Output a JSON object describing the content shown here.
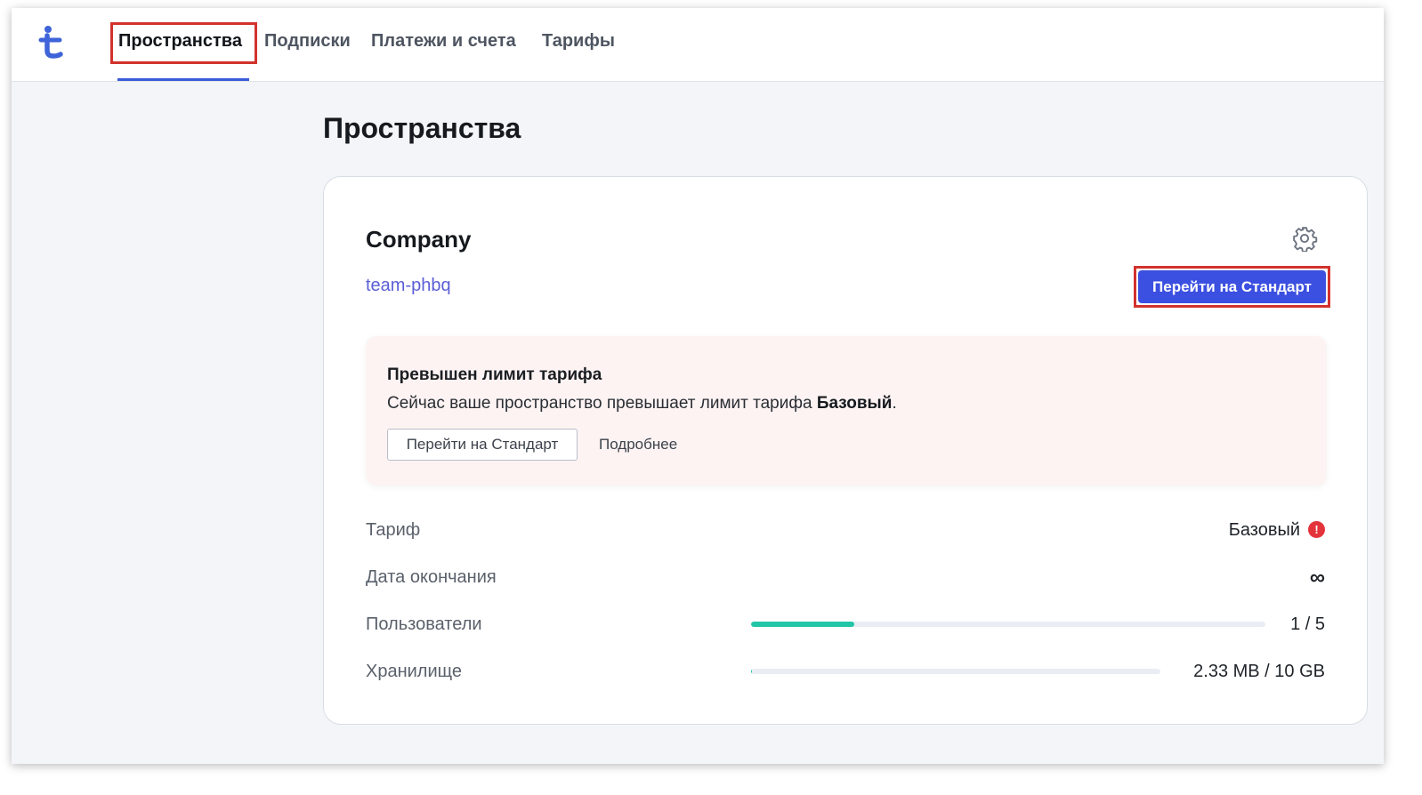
{
  "nav": {
    "items": [
      {
        "label": "Пространства",
        "active": true
      },
      {
        "label": "Подписки"
      },
      {
        "label": "Платежи и счета"
      },
      {
        "label": "Тарифы"
      }
    ]
  },
  "page": {
    "title": "Пространства"
  },
  "workspace": {
    "name": "Company",
    "slug": "team-phbq",
    "upgrade_label": "Перейти на Стандарт",
    "settings_icon": "gear-icon"
  },
  "alert": {
    "title": "Превышен лимит тарифа",
    "text_prefix": "Сейчас ваше пространство превышает лимит тарифа ",
    "text_plan": "Базовый",
    "text_suffix": ".",
    "primary_label": "Перейти на Стандарт",
    "secondary_label": "Подробнее"
  },
  "details": {
    "plan": {
      "label": "Тариф",
      "value": "Базовый",
      "status_icon": "error-icon",
      "status_mark": "!"
    },
    "expiry": {
      "label": "Дата окончания",
      "value": "∞"
    },
    "users": {
      "label": "Пользователи",
      "value": "1 / 5",
      "fraction": 0.2
    },
    "storage": {
      "label": "Хранилище",
      "value": "2.33 MB / 10 GB",
      "fraction": 0.0002
    }
  },
  "colors": {
    "accent": "#3b4fe0",
    "nav_underline": "#3a5bd9",
    "highlight": "#d2322d",
    "progress": "#22c6a6",
    "error": "#e3343b",
    "link": "#5b5fd6"
  }
}
